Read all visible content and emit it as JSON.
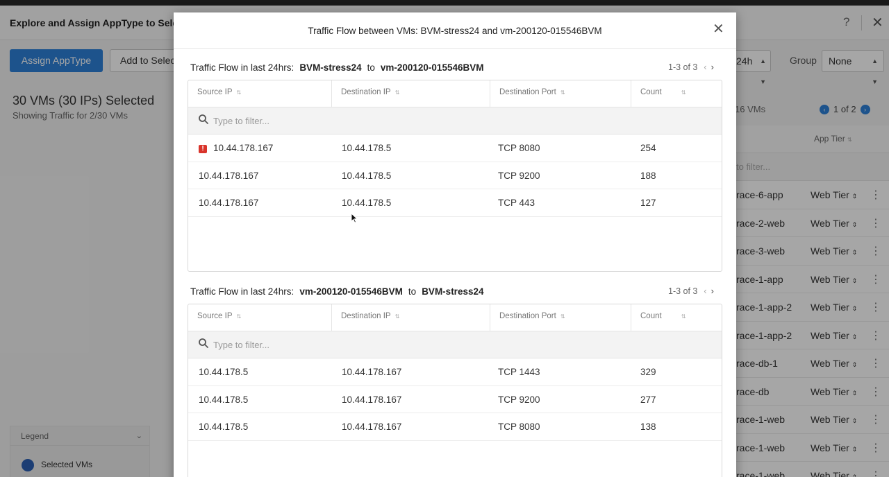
{
  "background": {
    "title": "Explore and Assign AppType to Selec",
    "help_icon": "?",
    "close_icon": "✕",
    "assign_button": "Assign AppType",
    "add_button": "Add to Selec",
    "selection_title": "30 VMs (30 IPs) Selected",
    "selection_subtitle": "Showing Traffic for 2/30 VMs",
    "time_range": "24h",
    "group_label": "Group",
    "group_value": "None",
    "vm_count": "16 VMs",
    "pager": {
      "current": "1",
      "of": "of",
      "total": "2"
    },
    "legend": {
      "title": "Legend",
      "item": "Selected VMs",
      "dot_color": "#2a5fb3"
    },
    "table": {
      "column": "App Tier",
      "filter_placeholder": "to filter...",
      "rows": [
        {
          "name": "race-6-app",
          "tier": "Web Tier"
        },
        {
          "name": "race-2-web",
          "tier": "Web Tier"
        },
        {
          "name": "race-3-web",
          "tier": "Web Tier"
        },
        {
          "name": "race-1-app",
          "tier": "Web Tier"
        },
        {
          "name": "race-1-app-2",
          "tier": "Web Tier"
        },
        {
          "name": "race-1-app-2",
          "tier": "Web Tier"
        },
        {
          "name": "race-db-1",
          "tier": "Web Tier"
        },
        {
          "name": "race-db",
          "tier": "Web Tier"
        },
        {
          "name": "race-1-web",
          "tier": "Web Tier"
        },
        {
          "name": "race-1-web",
          "tier": "Web Tier"
        },
        {
          "name": "race-1-web",
          "tier": "Web Tier"
        }
      ]
    }
  },
  "modal": {
    "title": "Traffic Flow between VMs: BVM-stress24 and vm-200120-015546BVM",
    "close_icon": "✕",
    "columns": {
      "source_ip": "Source IP",
      "destination_ip": "Destination IP",
      "destination_port": "Destination Port",
      "count": "Count"
    },
    "filter_placeholder": "Type to filter...",
    "sections": [
      {
        "label": "Traffic Flow in last 24hrs:",
        "from": "BVM-stress24",
        "to_word": "to",
        "to": "vm-200120-015546BVM",
        "pager": "1-3 of 3",
        "rows": [
          {
            "source": "10.44.178.167",
            "dest": "10.44.178.5",
            "port": "TCP  8080",
            "count": "254",
            "warning": true
          },
          {
            "source": "10.44.178.167",
            "dest": "10.44.178.5",
            "port": "TCP  9200",
            "count": "188",
            "warning": false
          },
          {
            "source": "10.44.178.167",
            "dest": "10.44.178.5",
            "port": "TCP  443",
            "count": "127",
            "warning": false
          }
        ]
      },
      {
        "label": "Traffic Flow in last 24hrs:",
        "from": "vm-200120-015546BVM",
        "to_word": "to",
        "to": "BVM-stress24",
        "pager": "1-3 of 3",
        "rows": [
          {
            "source": "10.44.178.5",
            "dest": "10.44.178.167",
            "port": "TCP  1443",
            "count": "329",
            "warning": false
          },
          {
            "source": "10.44.178.5",
            "dest": "10.44.178.167",
            "port": "TCP  9200",
            "count": "277",
            "warning": false
          },
          {
            "source": "10.44.178.5",
            "dest": "10.44.178.167",
            "port": "TCP  8080",
            "count": "138",
            "warning": false
          }
        ]
      }
    ]
  }
}
